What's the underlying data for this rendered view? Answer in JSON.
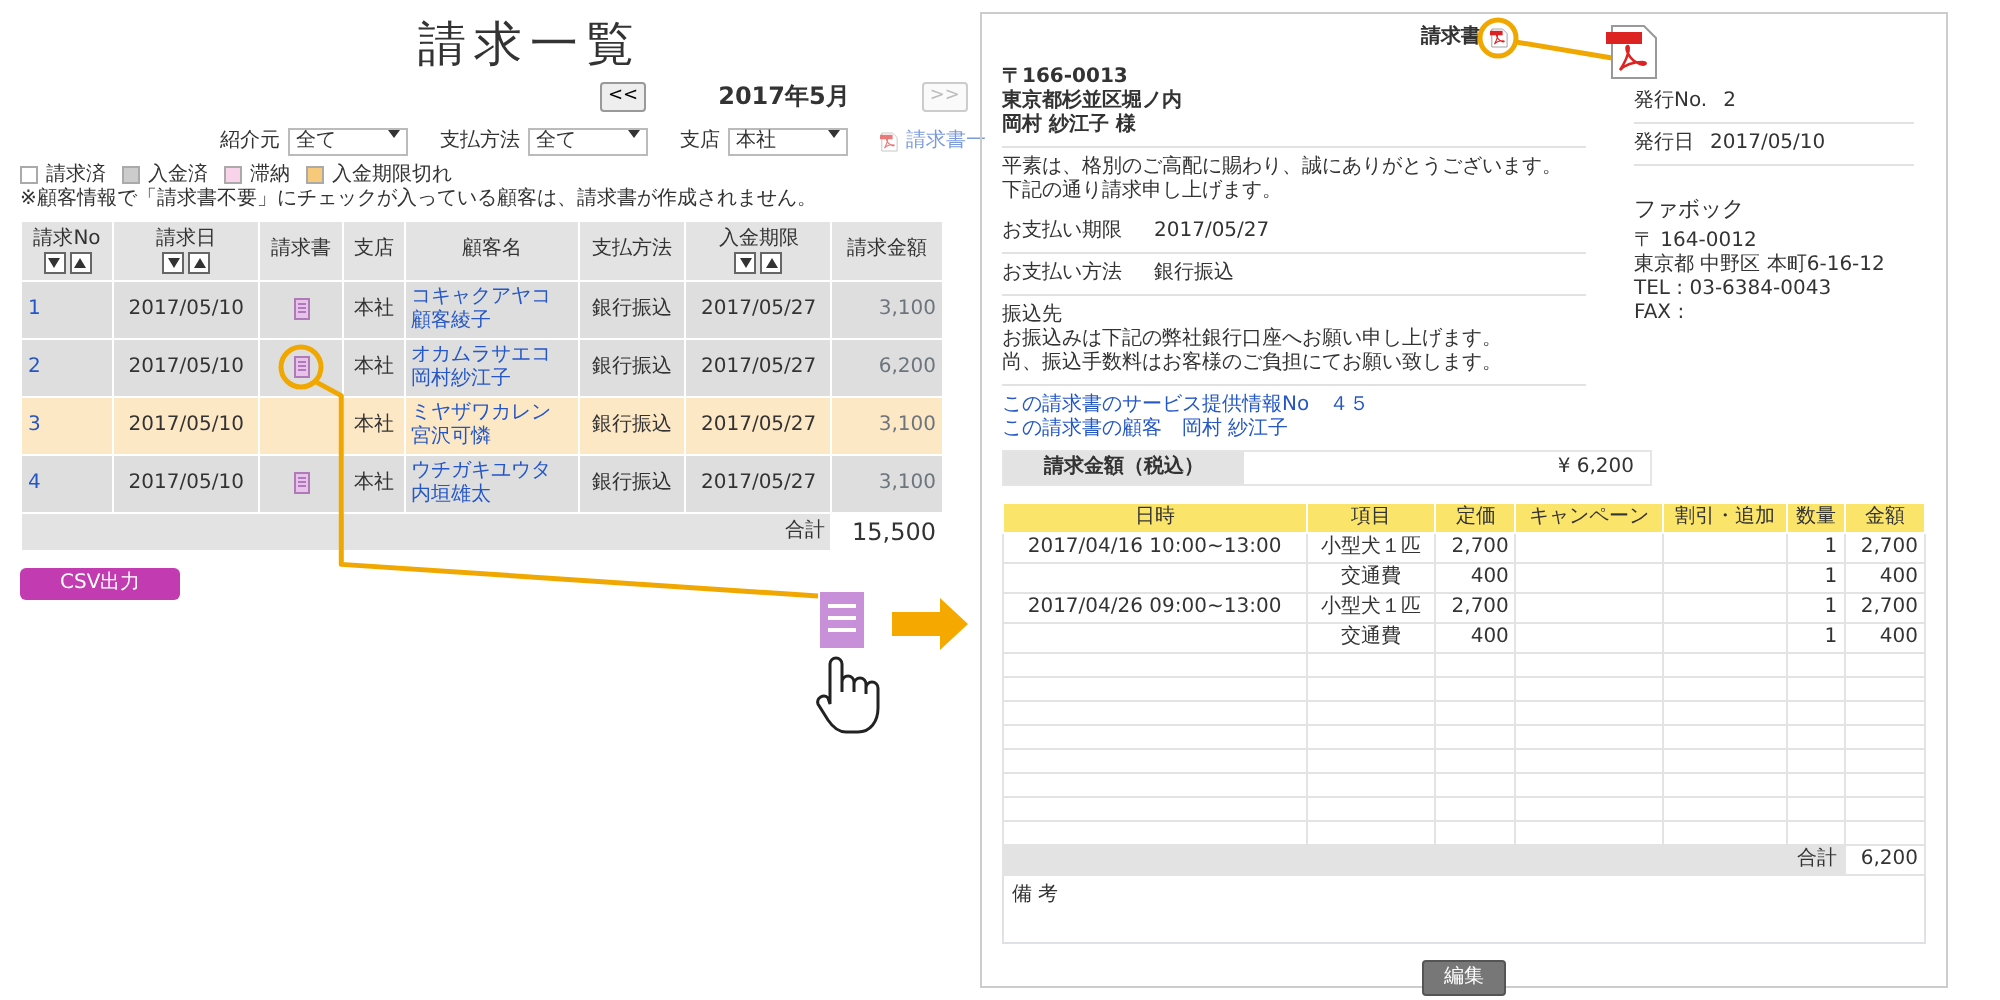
{
  "list_page": {
    "title": "請求一覧",
    "month_nav": {
      "prev": "<<",
      "month": "2017年5月",
      "next": ">>",
      "next_disabled": true
    },
    "filters": [
      {
        "label": "紹介元",
        "value": "全て"
      },
      {
        "label": "支払方法",
        "value": "全て"
      },
      {
        "label": "支店",
        "value": "本社"
      }
    ],
    "pdf_link": "請求書一",
    "legend": [
      {
        "label": "請求済",
        "color": "#ffffff"
      },
      {
        "label": "入金済",
        "color": "#cccccc"
      },
      {
        "label": "滞納",
        "color": "#f9d3ea"
      },
      {
        "label": "入金期限切れ",
        "color": "#f7c97a"
      }
    ],
    "note": "※顧客情報で「請求書不要」にチェックが入っている顧客は、請求書が作成されません。",
    "table": {
      "columns": [
        {
          "label": "請求No",
          "sortable": true
        },
        {
          "label": "請求日",
          "sortable": true
        },
        {
          "label": "請求書",
          "sortable": false
        },
        {
          "label": "支店",
          "sortable": false
        },
        {
          "label": "顧客名",
          "sortable": false
        },
        {
          "label": "支払方法",
          "sortable": false
        },
        {
          "label": "入金期限",
          "sortable": true
        },
        {
          "label": "請求金額",
          "sortable": false
        }
      ],
      "rows": [
        {
          "no": "1",
          "date": "2017/05/10",
          "has_invoice": true,
          "highlighted": false,
          "branch": "本社",
          "kana": "コキャクアヤコ",
          "name": "顧客綾子",
          "payment": "銀行振込",
          "due": "2017/05/27",
          "amount": "3,100",
          "color": "#dedede"
        },
        {
          "no": "2",
          "date": "2017/05/10",
          "has_invoice": true,
          "highlighted": true,
          "branch": "本社",
          "kana": "オカムラサエコ",
          "name": "岡村紗江子",
          "payment": "銀行振込",
          "due": "2017/05/27",
          "amount": "6,200",
          "color": "#dedede"
        },
        {
          "no": "3",
          "date": "2017/05/10",
          "has_invoice": false,
          "highlighted": false,
          "branch": "本社",
          "kana": "ミヤザワカレン",
          "name": "宮沢可憐",
          "payment": "銀行振込",
          "due": "2017/05/27",
          "amount": "3,100",
          "color": "#fde8c6"
        },
        {
          "no": "4",
          "date": "2017/05/10",
          "has_invoice": true,
          "highlighted": false,
          "branch": "本社",
          "kana": "ウチガキユウタ",
          "name": "内垣雄太",
          "payment": "銀行振込",
          "due": "2017/05/27",
          "amount": "3,100",
          "color": "#dedede"
        }
      ],
      "total_label": "合計",
      "total": "15,500"
    },
    "csv_button": "CSV出力"
  },
  "invoice": {
    "title": "請求書",
    "pdf_highlighted": true,
    "address": [
      "〒166-0013",
      "東京都杉並区堀ノ内",
      "岡村 紗江子 様"
    ],
    "issue": [
      {
        "label": "発行No.",
        "value": "2"
      },
      {
        "label": "発行日",
        "value": "2017/05/10"
      }
    ],
    "company": {
      "name": "ファボック",
      "lines": [
        "〒 164-0012",
        "東京都 中野区 本町6-16-12",
        "TEL : 03-6384-0043",
        "FAX :"
      ]
    },
    "greeting": [
      "平素は、格別のご高配に賜わり、誠にありがとうございます。",
      "下記の通り請求申し上げます。"
    ],
    "payment_rows": [
      {
        "label": "お支払い期限",
        "value": "2017/05/27"
      },
      {
        "label": "お支払い方法",
        "value": "銀行振込"
      }
    ],
    "bank": {
      "label": "振込先",
      "lines": [
        "お振込みは下記の弊社銀行口座へお願い申し上げます。",
        "尚、振込手数料はお客様のご負担にてお願い致します。"
      ]
    },
    "links": [
      "この請求書のサービス提供情報No　４５",
      "この請求書の顧客　岡村 紗江子"
    ],
    "amount_label": "請求金額（税込）",
    "amount": "¥ 6,200",
    "items": {
      "columns": [
        "日時",
        "項目",
        "定価",
        "キャンペーン",
        "割引・追加",
        "数量",
        "金額"
      ],
      "rows": [
        [
          "2017/04/16 10:00~13:00",
          "小型犬１匹",
          "2,700",
          "",
          "",
          "1",
          "2,700"
        ],
        [
          "",
          "交通費",
          "400",
          "",
          "",
          "1",
          "400"
        ],
        [
          "2017/04/26 09:00~13:00",
          "小型犬１匹",
          "2,700",
          "",
          "",
          "1",
          "2,700"
        ],
        [
          "",
          "交通費",
          "400",
          "",
          "",
          "1",
          "400"
        ]
      ],
      "total_label": "合計",
      "total": "6,200"
    },
    "remarks_label": "備 考",
    "edit_button": "編集"
  }
}
